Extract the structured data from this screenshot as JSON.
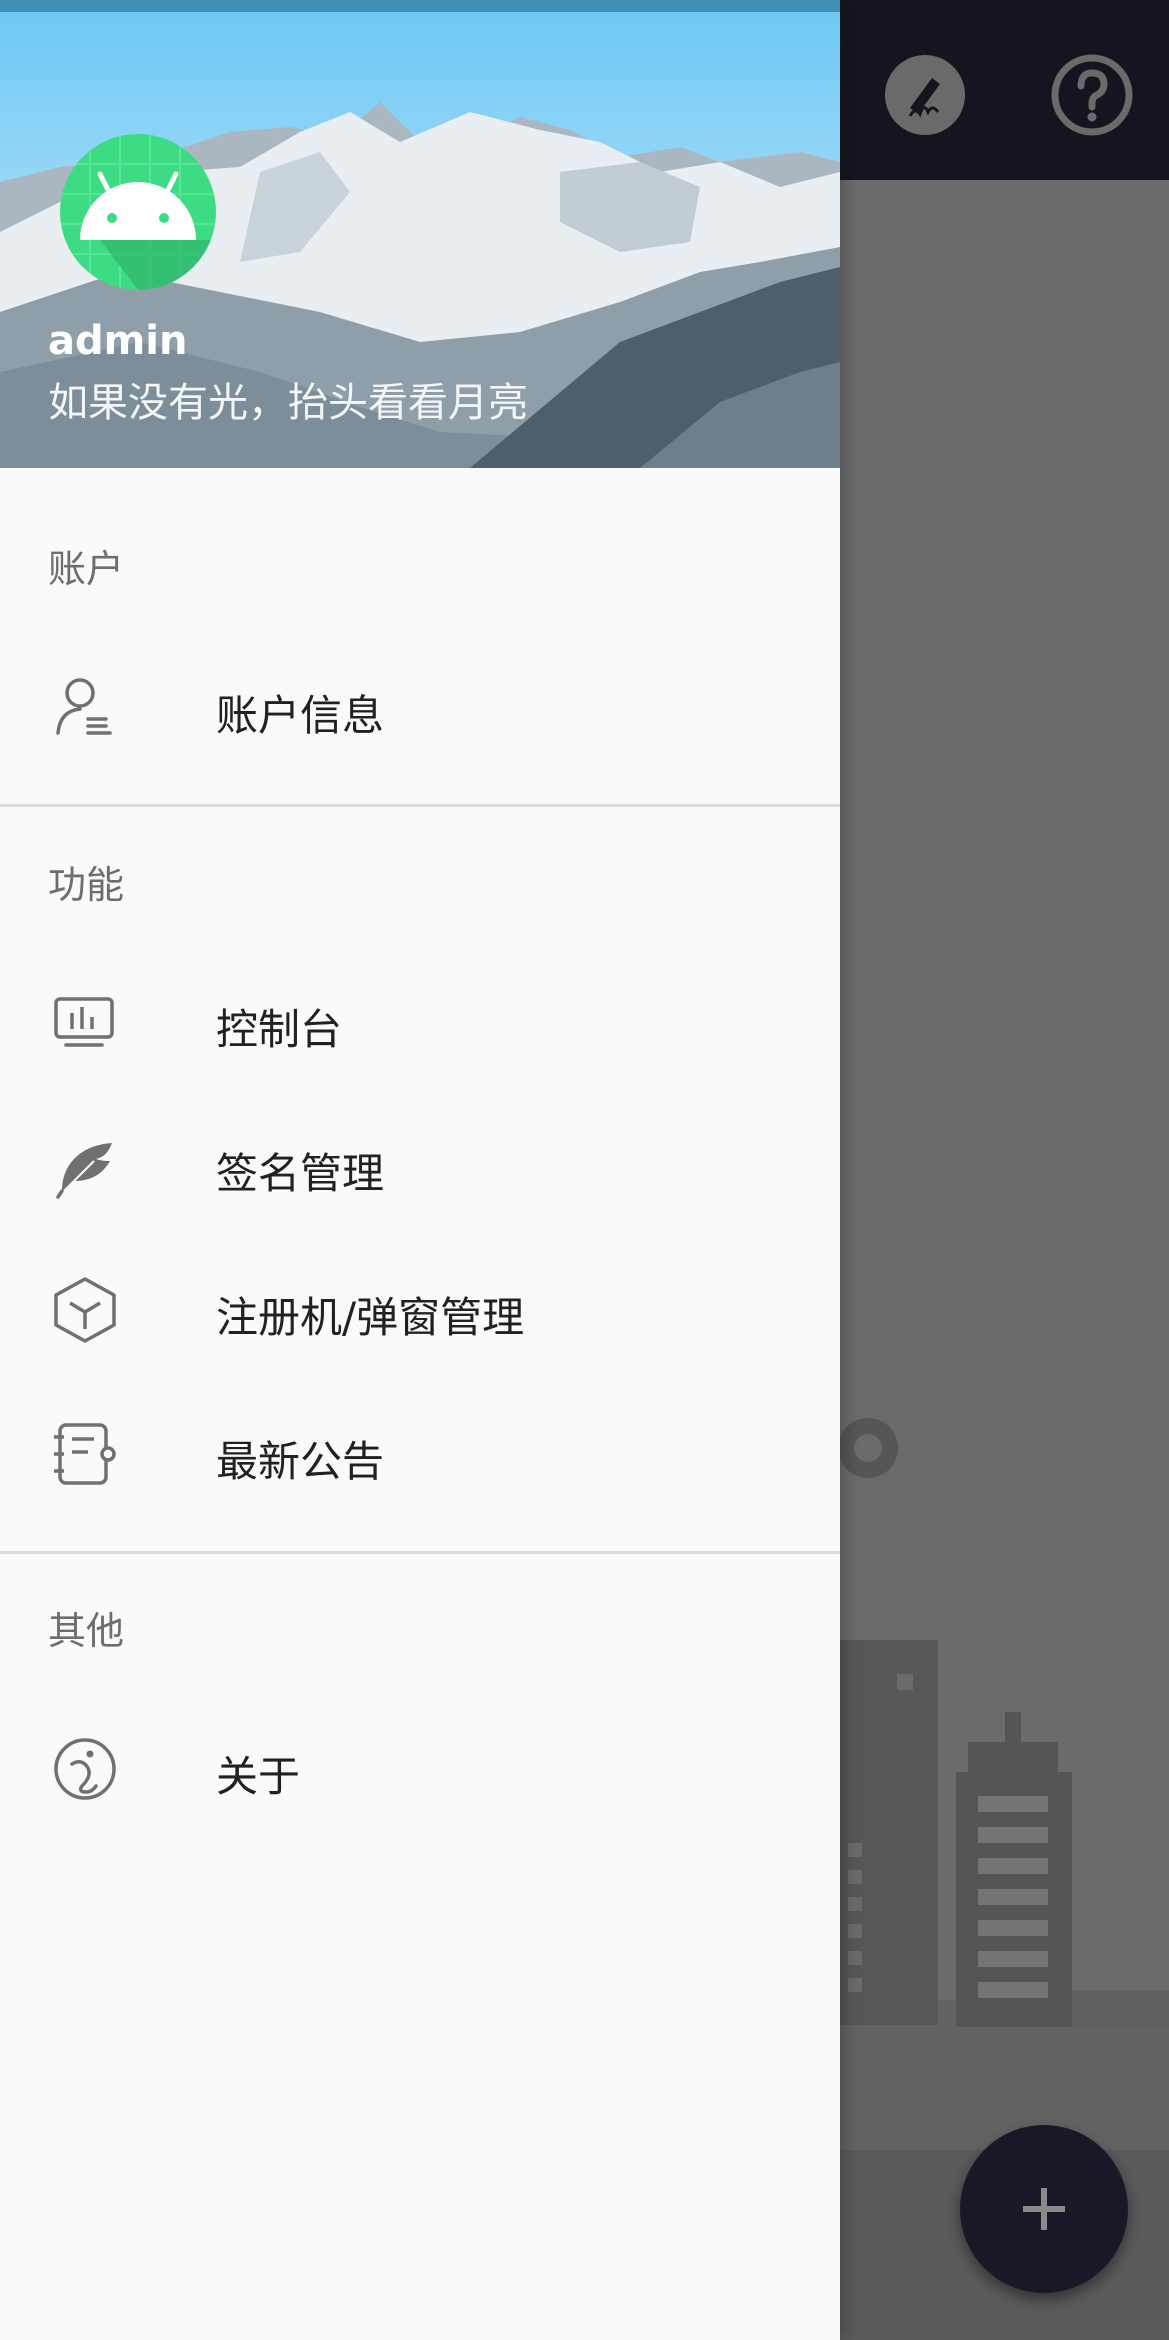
{
  "user": {
    "name": "admin",
    "motto": "如果没有光，抬头看看月亮"
  },
  "sections": {
    "account": "账户",
    "features": "功能",
    "other": "其他"
  },
  "menu": {
    "account_info": "账户信息",
    "console": "控制台",
    "signature_mgmt": "签名管理",
    "register_popup_mgmt": "注册机/弹窗管理",
    "latest_notice": "最新公告",
    "about": "关于"
  },
  "icons": {
    "toolbar": [
      "signature-icon",
      "help-icon"
    ],
    "fab": "add-icon",
    "menu": [
      "user-info-icon",
      "console-icon",
      "feather-icon",
      "box-icon",
      "notice-icon",
      "info-icon"
    ]
  },
  "colors": {
    "toolbar": "#15151f",
    "drawer": "#fafafa",
    "fab": "#181827",
    "avatar": "#3ddc84"
  }
}
